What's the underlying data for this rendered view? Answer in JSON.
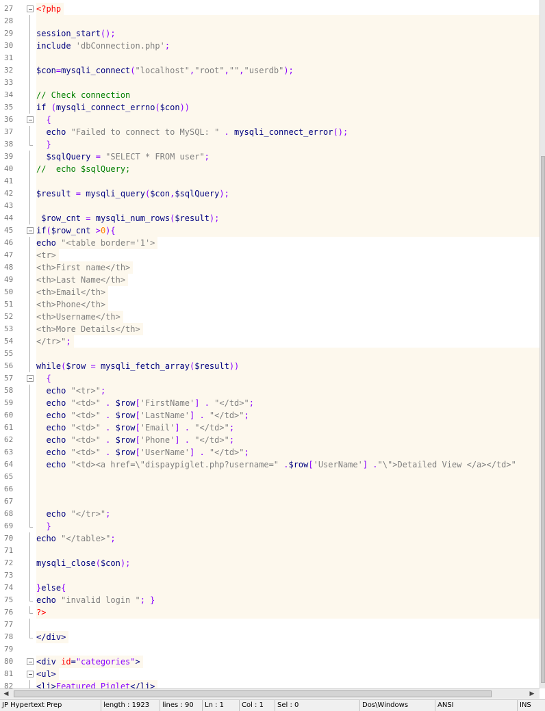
{
  "editor": {
    "lines": [
      {
        "n": "27",
        "fold": "box",
        "bg": false,
        "tokens": [
          {
            "c": "tag",
            "t": "<?php"
          }
        ]
      },
      {
        "n": "28",
        "fold": "line",
        "bg": true,
        "tokens": []
      },
      {
        "n": "29",
        "fold": "line",
        "bg": true,
        "tokens": [
          {
            "c": "kw",
            "t": "session_start"
          },
          {
            "c": "op",
            "t": "();"
          }
        ]
      },
      {
        "n": "30",
        "fold": "line",
        "bg": true,
        "tokens": [
          {
            "c": "kw",
            "t": "include "
          },
          {
            "c": "str",
            "t": "'dbConnection.php'"
          },
          {
            "c": "op",
            "t": ";"
          }
        ]
      },
      {
        "n": "31",
        "fold": "line",
        "bg": true,
        "tokens": []
      },
      {
        "n": "32",
        "fold": "line",
        "bg": true,
        "tokens": [
          {
            "c": "var",
            "t": "$con"
          },
          {
            "c": "op",
            "t": "="
          },
          {
            "c": "kw",
            "t": "mysqli_connect"
          },
          {
            "c": "op",
            "t": "("
          },
          {
            "c": "str",
            "t": "\"localhost\""
          },
          {
            "c": "op",
            "t": ","
          },
          {
            "c": "str",
            "t": "\"root\""
          },
          {
            "c": "op",
            "t": ","
          },
          {
            "c": "str",
            "t": "\"\""
          },
          {
            "c": "op",
            "t": ","
          },
          {
            "c": "str",
            "t": "\"userdb\""
          },
          {
            "c": "op",
            "t": ");"
          }
        ]
      },
      {
        "n": "33",
        "fold": "line",
        "bg": true,
        "tokens": []
      },
      {
        "n": "34",
        "fold": "line",
        "bg": true,
        "tokens": [
          {
            "c": "cmt",
            "t": "// Check connection"
          }
        ]
      },
      {
        "n": "35",
        "fold": "line",
        "bg": true,
        "tokens": [
          {
            "c": "kw",
            "t": "if "
          },
          {
            "c": "op",
            "t": "("
          },
          {
            "c": "kw",
            "t": "mysqli_connect_errno"
          },
          {
            "c": "op",
            "t": "("
          },
          {
            "c": "var",
            "t": "$con"
          },
          {
            "c": "op",
            "t": "))"
          }
        ]
      },
      {
        "n": "36",
        "fold": "box",
        "bg": true,
        "tokens": [
          {
            "c": "op",
            "t": "  {"
          }
        ]
      },
      {
        "n": "37",
        "fold": "line",
        "bg": true,
        "tokens": [
          {
            "c": "kw",
            "t": "  echo "
          },
          {
            "c": "str",
            "t": "\"Failed to connect to MySQL: \""
          },
          {
            "c": "op",
            "t": " . "
          },
          {
            "c": "kw",
            "t": "mysqli_connect_error"
          },
          {
            "c": "op",
            "t": "();"
          }
        ]
      },
      {
        "n": "38",
        "fold": "tick",
        "bg": true,
        "tokens": [
          {
            "c": "op",
            "t": "  }"
          }
        ]
      },
      {
        "n": "39",
        "fold": "line",
        "bg": true,
        "tokens": [
          {
            "c": "var",
            "t": "  $sqlQuery"
          },
          {
            "c": "op",
            "t": " = "
          },
          {
            "c": "str",
            "t": "\"SELECT * FROM user\""
          },
          {
            "c": "op",
            "t": ";"
          }
        ]
      },
      {
        "n": "40",
        "fold": "line",
        "bg": true,
        "tokens": [
          {
            "c": "cmt",
            "t": "//  echo $sqlQuery;"
          }
        ]
      },
      {
        "n": "41",
        "fold": "line",
        "bg": true,
        "tokens": []
      },
      {
        "n": "42",
        "fold": "line",
        "bg": true,
        "tokens": [
          {
            "c": "var",
            "t": "$result"
          },
          {
            "c": "op",
            "t": " = "
          },
          {
            "c": "kw",
            "t": "mysqli_query"
          },
          {
            "c": "op",
            "t": "("
          },
          {
            "c": "var",
            "t": "$con"
          },
          {
            "c": "op",
            "t": ","
          },
          {
            "c": "var",
            "t": "$sqlQuery"
          },
          {
            "c": "op",
            "t": ");"
          }
        ]
      },
      {
        "n": "43",
        "fold": "line",
        "bg": true,
        "tokens": []
      },
      {
        "n": "44",
        "fold": "line",
        "bg": true,
        "tokens": [
          {
            "c": "var",
            "t": " $row_cnt"
          },
          {
            "c": "op",
            "t": " = "
          },
          {
            "c": "kw",
            "t": "mysqli_num_rows"
          },
          {
            "c": "op",
            "t": "("
          },
          {
            "c": "var",
            "t": "$result"
          },
          {
            "c": "op",
            "t": ");"
          }
        ]
      },
      {
        "n": "45",
        "fold": "box",
        "bg": true,
        "tokens": [
          {
            "c": "kw",
            "t": "if"
          },
          {
            "c": "op",
            "t": "("
          },
          {
            "c": "var",
            "t": "$row_cnt"
          },
          {
            "c": "op",
            "t": " >"
          },
          {
            "c": "num",
            "t": "0"
          },
          {
            "c": "op",
            "t": "){"
          }
        ]
      },
      {
        "n": "46",
        "fold": "line",
        "bg": false,
        "tokens": [
          {
            "c": "kw",
            "t": "echo "
          },
          {
            "c": "str",
            "t": "\"<table border='1'>"
          }
        ]
      },
      {
        "n": "47",
        "fold": "line",
        "bg": false,
        "tokens": [
          {
            "c": "str",
            "t": "<tr>"
          }
        ]
      },
      {
        "n": "48",
        "fold": "line",
        "bg": false,
        "tokens": [
          {
            "c": "str",
            "t": "<th>First name</th>"
          }
        ]
      },
      {
        "n": "49",
        "fold": "line",
        "bg": false,
        "tokens": [
          {
            "c": "str",
            "t": "<th>Last Name</th>"
          }
        ]
      },
      {
        "n": "50",
        "fold": "line",
        "bg": false,
        "tokens": [
          {
            "c": "str",
            "t": "<th>Email</th>"
          }
        ]
      },
      {
        "n": "51",
        "fold": "line",
        "bg": false,
        "tokens": [
          {
            "c": "str",
            "t": "<th>Phone</th>"
          }
        ]
      },
      {
        "n": "52",
        "fold": "line",
        "bg": false,
        "tokens": [
          {
            "c": "str",
            "t": "<th>Username</th>"
          }
        ]
      },
      {
        "n": "53",
        "fold": "line",
        "bg": false,
        "tokens": [
          {
            "c": "str",
            "t": "<th>More Details</th>"
          }
        ]
      },
      {
        "n": "54",
        "fold": "line",
        "bg": false,
        "tokens": [
          {
            "c": "str",
            "t": "</tr>\""
          },
          {
            "c": "op",
            "t": ";"
          }
        ]
      },
      {
        "n": "55",
        "fold": "line",
        "bg": true,
        "tokens": []
      },
      {
        "n": "56",
        "fold": "line",
        "bg": true,
        "tokens": [
          {
            "c": "kw",
            "t": "while"
          },
          {
            "c": "op",
            "t": "("
          },
          {
            "c": "var",
            "t": "$row"
          },
          {
            "c": "op",
            "t": " = "
          },
          {
            "c": "kw",
            "t": "mysqli_fetch_array"
          },
          {
            "c": "op",
            "t": "("
          },
          {
            "c": "var",
            "t": "$result"
          },
          {
            "c": "op",
            "t": "))"
          }
        ]
      },
      {
        "n": "57",
        "fold": "box",
        "bg": true,
        "tokens": [
          {
            "c": "op",
            "t": "  {"
          }
        ]
      },
      {
        "n": "58",
        "fold": "line",
        "bg": true,
        "tokens": [
          {
            "c": "kw",
            "t": "  echo "
          },
          {
            "c": "str",
            "t": "\"<tr>\""
          },
          {
            "c": "op",
            "t": ";"
          }
        ]
      },
      {
        "n": "59",
        "fold": "line",
        "bg": true,
        "tokens": [
          {
            "c": "kw",
            "t": "  echo "
          },
          {
            "c": "str",
            "t": "\"<td>\""
          },
          {
            "c": "op",
            "t": " . "
          },
          {
            "c": "var",
            "t": "$row"
          },
          {
            "c": "op",
            "t": "["
          },
          {
            "c": "str",
            "t": "'FirstName'"
          },
          {
            "c": "op",
            "t": "] . "
          },
          {
            "c": "str",
            "t": "\"</td>\""
          },
          {
            "c": "op",
            "t": ";"
          }
        ]
      },
      {
        "n": "60",
        "fold": "line",
        "bg": true,
        "tokens": [
          {
            "c": "kw",
            "t": "  echo "
          },
          {
            "c": "str",
            "t": "\"<td>\""
          },
          {
            "c": "op",
            "t": " . "
          },
          {
            "c": "var",
            "t": "$row"
          },
          {
            "c": "op",
            "t": "["
          },
          {
            "c": "str",
            "t": "'LastName'"
          },
          {
            "c": "op",
            "t": "] . "
          },
          {
            "c": "str",
            "t": "\"</td>\""
          },
          {
            "c": "op",
            "t": ";"
          }
        ]
      },
      {
        "n": "61",
        "fold": "line",
        "bg": true,
        "tokens": [
          {
            "c": "kw",
            "t": "  echo "
          },
          {
            "c": "str",
            "t": "\"<td>\""
          },
          {
            "c": "op",
            "t": " . "
          },
          {
            "c": "var",
            "t": "$row"
          },
          {
            "c": "op",
            "t": "["
          },
          {
            "c": "str",
            "t": "'Email'"
          },
          {
            "c": "op",
            "t": "] . "
          },
          {
            "c": "str",
            "t": "\"</td>\""
          },
          {
            "c": "op",
            "t": ";"
          }
        ]
      },
      {
        "n": "62",
        "fold": "line",
        "bg": true,
        "tokens": [
          {
            "c": "kw",
            "t": "  echo "
          },
          {
            "c": "str",
            "t": "\"<td>\""
          },
          {
            "c": "op",
            "t": " . "
          },
          {
            "c": "var",
            "t": "$row"
          },
          {
            "c": "op",
            "t": "["
          },
          {
            "c": "str",
            "t": "'Phone'"
          },
          {
            "c": "op",
            "t": "] . "
          },
          {
            "c": "str",
            "t": "\"</td>\""
          },
          {
            "c": "op",
            "t": ";"
          }
        ]
      },
      {
        "n": "63",
        "fold": "line",
        "bg": true,
        "tokens": [
          {
            "c": "kw",
            "t": "  echo "
          },
          {
            "c": "str",
            "t": "\"<td>\""
          },
          {
            "c": "op",
            "t": " . "
          },
          {
            "c": "var",
            "t": "$row"
          },
          {
            "c": "op",
            "t": "["
          },
          {
            "c": "str",
            "t": "'UserName'"
          },
          {
            "c": "op",
            "t": "] . "
          },
          {
            "c": "str",
            "t": "\"</td>\""
          },
          {
            "c": "op",
            "t": ";"
          }
        ]
      },
      {
        "n": "64",
        "fold": "line",
        "bg": true,
        "tokens": [
          {
            "c": "kw",
            "t": "  echo "
          },
          {
            "c": "str",
            "t": "\"<td><a href=\\\"dispaypiglet.php?username=\""
          },
          {
            "c": "op",
            "t": " ."
          },
          {
            "c": "var",
            "t": "$row"
          },
          {
            "c": "op",
            "t": "["
          },
          {
            "c": "str",
            "t": "'UserName'"
          },
          {
            "c": "op",
            "t": "] ."
          },
          {
            "c": "str",
            "t": "\"\\\">Detailed View </a></td>\""
          }
        ]
      },
      {
        "n": "65",
        "fold": "line",
        "bg": true,
        "tokens": []
      },
      {
        "n": "66",
        "fold": "line",
        "bg": true,
        "tokens": []
      },
      {
        "n": "67",
        "fold": "line",
        "bg": true,
        "tokens": []
      },
      {
        "n": "68",
        "fold": "line",
        "bg": true,
        "tokens": [
          {
            "c": "kw",
            "t": "  echo "
          },
          {
            "c": "str",
            "t": "\"</tr>\""
          },
          {
            "c": "op",
            "t": ";"
          }
        ]
      },
      {
        "n": "69",
        "fold": "tick",
        "bg": true,
        "tokens": [
          {
            "c": "op",
            "t": "  }"
          }
        ]
      },
      {
        "n": "70",
        "fold": "line",
        "bg": true,
        "tokens": [
          {
            "c": "kw",
            "t": "echo "
          },
          {
            "c": "str",
            "t": "\"</table>\""
          },
          {
            "c": "op",
            "t": ";"
          }
        ]
      },
      {
        "n": "71",
        "fold": "line",
        "bg": true,
        "tokens": []
      },
      {
        "n": "72",
        "fold": "line",
        "bg": true,
        "tokens": [
          {
            "c": "kw",
            "t": "mysqli_close"
          },
          {
            "c": "op",
            "t": "("
          },
          {
            "c": "var",
            "t": "$con"
          },
          {
            "c": "op",
            "t": ");"
          }
        ]
      },
      {
        "n": "73",
        "fold": "line",
        "bg": true,
        "tokens": []
      },
      {
        "n": "74",
        "fold": "line",
        "bg": true,
        "tokens": [
          {
            "c": "op",
            "t": "}"
          },
          {
            "c": "kw",
            "t": "else"
          },
          {
            "c": "op",
            "t": "{"
          }
        ]
      },
      {
        "n": "75",
        "fold": "tick",
        "bg": true,
        "tokens": [
          {
            "c": "kw",
            "t": "echo "
          },
          {
            "c": "str",
            "t": "\"invalid login \""
          },
          {
            "c": "op",
            "t": "; }"
          }
        ]
      },
      {
        "n": "76",
        "fold": "tick",
        "bg": true,
        "tokens": [
          {
            "c": "tag",
            "t": "?>"
          }
        ]
      },
      {
        "n": "77",
        "fold": "line",
        "bg": false,
        "tokens": []
      },
      {
        "n": "78",
        "fold": "tick",
        "bg": false,
        "tokens": [
          {
            "c": "html",
            "t": "</div>"
          }
        ]
      },
      {
        "n": "79",
        "fold": "none",
        "bg": false,
        "tokens": []
      },
      {
        "n": "80",
        "fold": "box",
        "bg": false,
        "tokens": [
          {
            "c": "html",
            "t": "<div "
          },
          {
            "c": "attr",
            "t": "id"
          },
          {
            "c": "html",
            "t": "="
          },
          {
            "c": "op",
            "t": "\"categories\""
          },
          {
            "c": "html",
            "t": ">"
          }
        ]
      },
      {
        "n": "81",
        "fold": "box",
        "bg": false,
        "tokens": [
          {
            "c": "html",
            "t": "<ul>"
          }
        ]
      },
      {
        "n": "82",
        "fold": "line",
        "bg": false,
        "tokens": [
          {
            "c": "html",
            "t": "<li>"
          },
          {
            "c": "op",
            "t": "Featured Piglet"
          },
          {
            "c": "html",
            "t": "</li>"
          }
        ]
      }
    ]
  },
  "status_bar": {
    "file_type": "JP Hypertext Prep",
    "length": "length : 1923",
    "lines": "lines : 90",
    "ln": "Ln : 1",
    "col": "Col : 1",
    "sel": "Sel : 0",
    "eol": "Dos\\Windows",
    "encoding": "ANSI",
    "mode": "INS"
  },
  "colors": {
    "keyword": "#00007f",
    "string": "#7f7f7f",
    "operator": "#8800ff",
    "comment": "#007f00",
    "php_tag": "#ff0000",
    "php_background": "#fdf8ed"
  }
}
